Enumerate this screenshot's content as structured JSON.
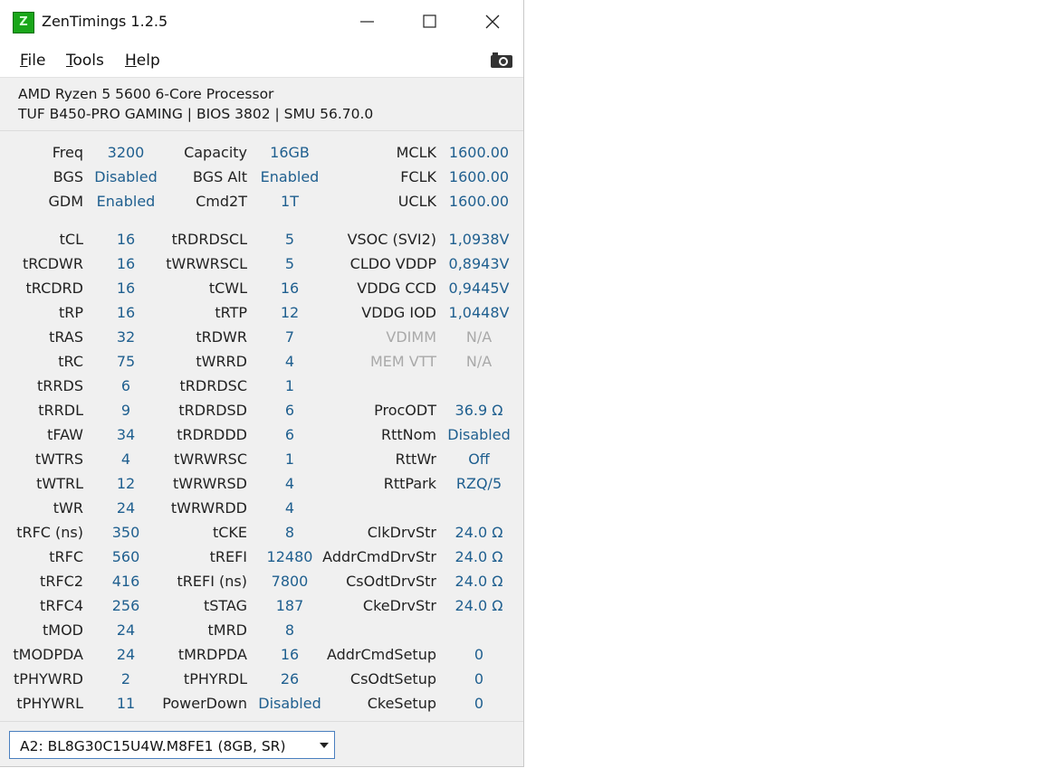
{
  "window": {
    "title": "ZenTimings 1.2.5",
    "icon": "zentimings-z-icon"
  },
  "menu": {
    "items": [
      {
        "label_accel": "F",
        "label_rest": "ile"
      },
      {
        "label_accel": "T",
        "label_rest": "ools"
      },
      {
        "label_accel": "H",
        "label_rest": "elp"
      }
    ],
    "screenshot_icon": "camera-icon"
  },
  "system": {
    "cpu": "AMD Ryzen 5 5600 6-Core Processor",
    "board": "TUF B450-PRO GAMING | BIOS 3802 | SMU 56.70.0"
  },
  "timings": [
    [
      "Freq",
      "3200",
      "Capacity",
      "16GB",
      "MCLK",
      "1600.00"
    ],
    [
      "BGS",
      "Disabled",
      "BGS Alt",
      "Enabled",
      "FCLK",
      "1600.00"
    ],
    [
      "GDM",
      "Enabled",
      "Cmd2T",
      "1T",
      "UCLK",
      "1600.00"
    ],
    [
      "tCL",
      "16",
      "tRDRDSCL",
      "5",
      "VSOC (SVI2)",
      "1,0938V"
    ],
    [
      "tRCDWR",
      "16",
      "tWRWRSCL",
      "5",
      "CLDO VDDP",
      "0,8943V"
    ],
    [
      "tRCDRD",
      "16",
      "tCWL",
      "16",
      "VDDG CCD",
      "0,9445V"
    ],
    [
      "tRP",
      "16",
      "tRTP",
      "12",
      "VDDG IOD",
      "1,0448V"
    ],
    [
      "tRAS",
      "32",
      "tRDWR",
      "7",
      "VDIMM",
      "N/A"
    ],
    [
      "tRC",
      "75",
      "tWRRD",
      "4",
      "MEM VTT",
      "N/A"
    ],
    [
      "tRRDS",
      "6",
      "tRDRDSC",
      "1",
      "",
      ""
    ],
    [
      "tRRDL",
      "9",
      "tRDRDSD",
      "6",
      "ProcODT",
      "36.9 Ω"
    ],
    [
      "tFAW",
      "34",
      "tRDRDDD",
      "6",
      "RttNom",
      "Disabled"
    ],
    [
      "tWTRS",
      "4",
      "tWRWRSC",
      "1",
      "RttWr",
      "Off"
    ],
    [
      "tWTRL",
      "12",
      "tWRWRSD",
      "4",
      "RttPark",
      "RZQ/5"
    ],
    [
      "tWR",
      "24",
      "tWRWRDD",
      "4",
      "",
      ""
    ],
    [
      "tRFC (ns)",
      "350",
      "tCKE",
      "8",
      "ClkDrvStr",
      "24.0 Ω"
    ],
    [
      "tRFC",
      "560",
      "tREFI",
      "12480",
      "AddrCmdDrvStr",
      "24.0 Ω"
    ],
    [
      "tRFC2",
      "416",
      "tREFI (ns)",
      "7800",
      "CsOdtDrvStr",
      "24.0 Ω"
    ],
    [
      "tRFC4",
      "256",
      "tSTAG",
      "187",
      "CkeDrvStr",
      "24.0 Ω"
    ],
    [
      "tMOD",
      "24",
      "tMRD",
      "8",
      "",
      ""
    ],
    [
      "tMODPDA",
      "24",
      "tMRDPDA",
      "16",
      "AddrCmdSetup",
      "0"
    ],
    [
      "tPHYWRD",
      "2",
      "tPHYRDL",
      "26",
      "CsOdtSetup",
      "0"
    ],
    [
      "tPHYWRL",
      "11",
      "PowerDown",
      "Disabled",
      "CkeSetup",
      "0"
    ]
  ],
  "dimmed_labels": [
    "VDIMM",
    "MEM VTT"
  ],
  "dimm_selector": {
    "selected": "A2: BL8G30C15U4W.M8FE1 (8GB, SR)"
  },
  "colors": {
    "value": "#1f5f8f",
    "dimmed": "#a9a9a9",
    "accent": "#4a7fbf"
  }
}
